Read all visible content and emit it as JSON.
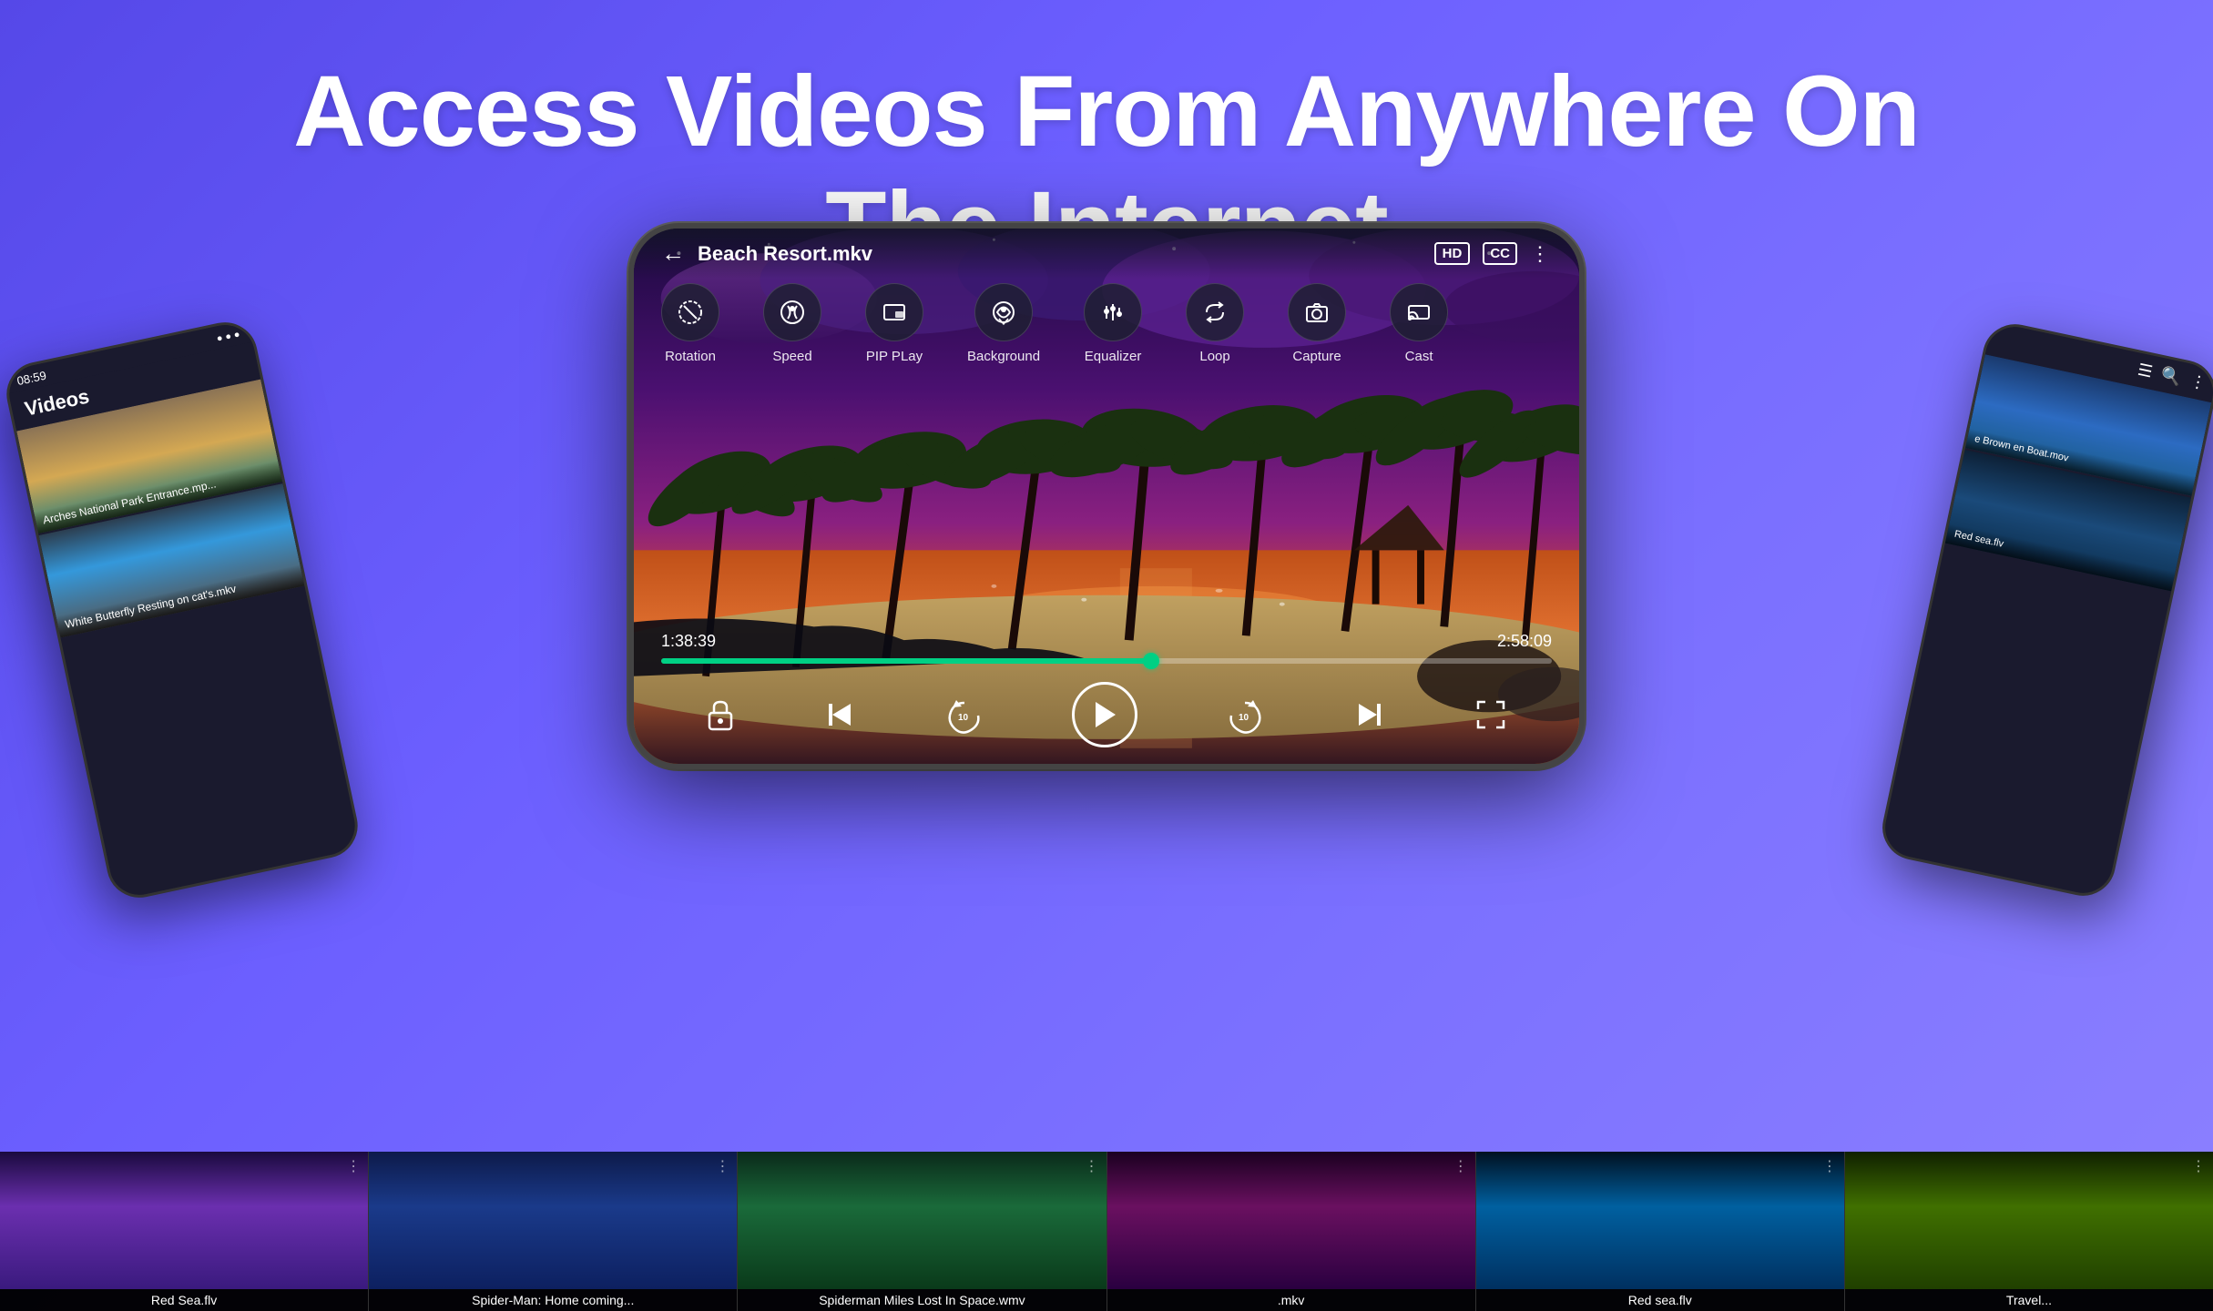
{
  "headline": {
    "line1": "Access Videos From Anywhere On",
    "line2": "The Internet"
  },
  "phone_center": {
    "title": "Beach Resort.mkv",
    "hd_badge": "HD",
    "cc_badge": "CC",
    "time_current": "1:38:39",
    "time_total": "2:58:09",
    "controls": [
      {
        "id": "rotation",
        "label": "Rotation",
        "icon": "⊘"
      },
      {
        "id": "speed",
        "label": "Speed",
        "icon": "⚙"
      },
      {
        "id": "pip",
        "label": "PIP PLay",
        "icon": "▣"
      },
      {
        "id": "background",
        "label": "Background",
        "icon": "🎧"
      },
      {
        "id": "equalizer",
        "label": "Equalizer",
        "icon": "⊞"
      },
      {
        "id": "loop",
        "label": "Loop",
        "icon": "↻"
      },
      {
        "id": "capture",
        "label": "Capture",
        "icon": "📷"
      },
      {
        "id": "cast",
        "label": "Cast",
        "icon": "⊟"
      }
    ]
  },
  "phone_left": {
    "status_time": "08:59",
    "header": "Videos",
    "items": [
      {
        "label": "Arches National Park Entrance.mp..."
      },
      {
        "label": "White Butterfly Resting on cat's.mkv"
      }
    ]
  },
  "phone_right": {
    "items": [
      {
        "label": "e Brown\nen Boat.mov"
      },
      {
        "label": "Red sea.flv"
      }
    ]
  },
  "filmstrip": {
    "items": [
      {
        "label": "Red Sea.flv"
      },
      {
        "label": "Spider-Man: Home coming..."
      },
      {
        "label": "Spiderman Miles Lost In Space.wmv"
      },
      {
        "label": ".mkv"
      },
      {
        "label": "Red sea.flv"
      },
      {
        "label": "Travel..."
      }
    ]
  }
}
